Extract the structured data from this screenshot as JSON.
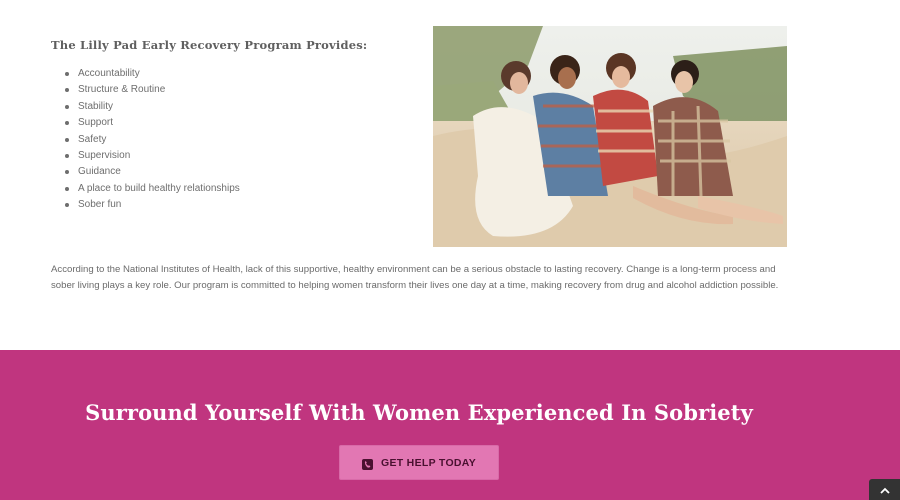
{
  "main": {
    "heading": "The Lilly Pad Early Recovery Program Provides:",
    "features": [
      "Accountability",
      "Structure & Routine",
      "Stability",
      "Support",
      "Safety",
      "Supervision",
      "Guidance",
      "A place to build healthy relationships",
      "Sober fun"
    ],
    "paragraph": "According to the National Institutes of Health, lack of this supportive, healthy environment can be a serious obstacle to lasting recovery. Change is a long-term process and sober living plays a key role. Our program is committed to helping women transform their lives one day at a time, making recovery from drug and alcohol addiction possible."
  },
  "cta": {
    "title": "Surround Yourself With Women Experienced In Sobriety",
    "button_label": "GET HELP TODAY",
    "button_icon": "phone-icon"
  },
  "scroll_top": {
    "icon": "chevron-up-icon"
  },
  "colors": {
    "cta_background": "#c0357f",
    "cta_button": "#e277b3",
    "cta_button_text": "#4a1030",
    "body_text": "#6b6b6b"
  }
}
